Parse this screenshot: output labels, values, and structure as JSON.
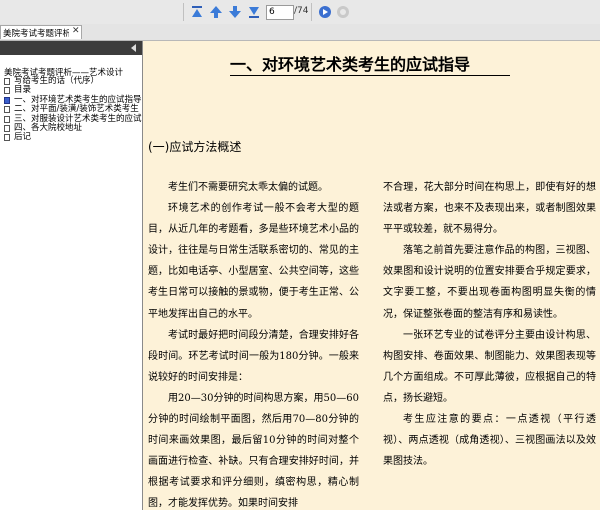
{
  "toolbar": {
    "page_value": "6",
    "page_total": "/74",
    "icons": [
      "first-page-icon",
      "prev-page-icon",
      "next-page-icon",
      "last-page-icon",
      "go-icon",
      "stop-icon"
    ]
  },
  "tab": {
    "label": "美院考试考题评析：艺术...",
    "close": "✕"
  },
  "sidebar": {
    "title": "美院考试考题评析——艺术设计",
    "items": [
      {
        "label": "写给考生的话（代序）",
        "active": false
      },
      {
        "label": "目录",
        "active": false
      },
      {
        "label": "一、对环境艺术类考生的应试指导",
        "active": true
      },
      {
        "label": "二、对平面/装潢/装饰艺术类考生",
        "active": false
      },
      {
        "label": "三、对服装设计艺术类考生的应试",
        "active": false
      },
      {
        "label": "四、各大院校地址",
        "active": false
      },
      {
        "label": "后记",
        "active": false
      }
    ]
  },
  "document": {
    "title": "一、对环境艺术类考生的应试指导",
    "section": "(一)应试方法概述",
    "left_paragraphs": [
      "考生们不需要研究太乖太偏的试题。",
      "环境艺术的创作考试一般不会考大型的题目，从近几年的考题看，多是些环境艺术小品的设计，往往是与日常生活联系密切的、常见的主题，比如电话亭、小型居室、公共空间等，这些考生日常可以接触的景或物，便于考生正常、公平地发挥出自己的水平。",
      "考试时最好把时间段分清楚，合理安排好各段时间。环艺考试时间一般为180分钟。一般来说较好的时间安排是：",
      "用20—30分钟的时间构思方案，用50—60分钟的时间绘制平面图，然后用70—80分钟的时间来画效果图，最后留10分钟的时间对整个画面进行检查、补缺。只有合理安排好时间，并根据考试要求和评分细则，缜密构思，精心制图，才能发挥优势。如果时间安排"
    ],
    "right_paragraphs": [
      "不合理，花大部分时间在构思上，即使有好的想法或者方案，也来不及表现出来，或者制图效果平平或较差，就不易得分。",
      "落笔之前首先要注意作品的构图，三视图、效果图和设计说明的位置安排要合乎规定要求，文字要工整，不要出现卷面构图明显失衡的情况，保证整张卷面的整洁有序和易读性。",
      "一张环艺专业的试卷评分主要由设计构思、构图安排、卷面效果、制图能力、效果图表现等几个方面组成。不可厚此薄彼，应根据自己的特点，扬长避短。",
      "考生应注意的要点：一点透视（平行透视）、两点透视（成角透视）、三视图画法以及效果图技法。"
    ]
  }
}
